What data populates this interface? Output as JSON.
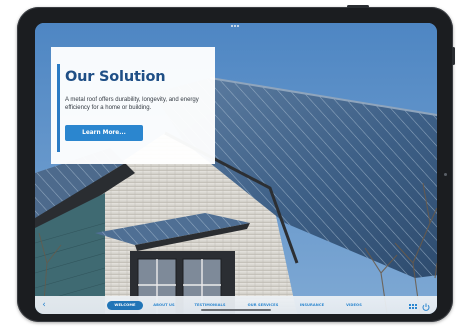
{
  "hero": {
    "title": "Our Solution",
    "description": "A metal roof offers durability, longevity, and energy efficiency for a home or building.",
    "cta_label": "Learn More..."
  },
  "nav": {
    "tabs": [
      {
        "label": "WELCOME",
        "active": true
      },
      {
        "label": "ABOUT US",
        "active": false
      },
      {
        "label": "TESTIMONIALS",
        "active": false
      },
      {
        "label": "OUR SERVICES",
        "active": false
      },
      {
        "label": "INSURANCE",
        "active": false
      },
      {
        "label": "VIDEOS",
        "active": false
      }
    ],
    "back_icon": "chevron-left-icon",
    "menu_icon": "grid-icon",
    "power_icon": "power-icon"
  },
  "colors": {
    "accent": "#2b86cf",
    "title": "#1f4f86",
    "active_tab": "#2175b7",
    "sky": "#5b8fc4"
  }
}
